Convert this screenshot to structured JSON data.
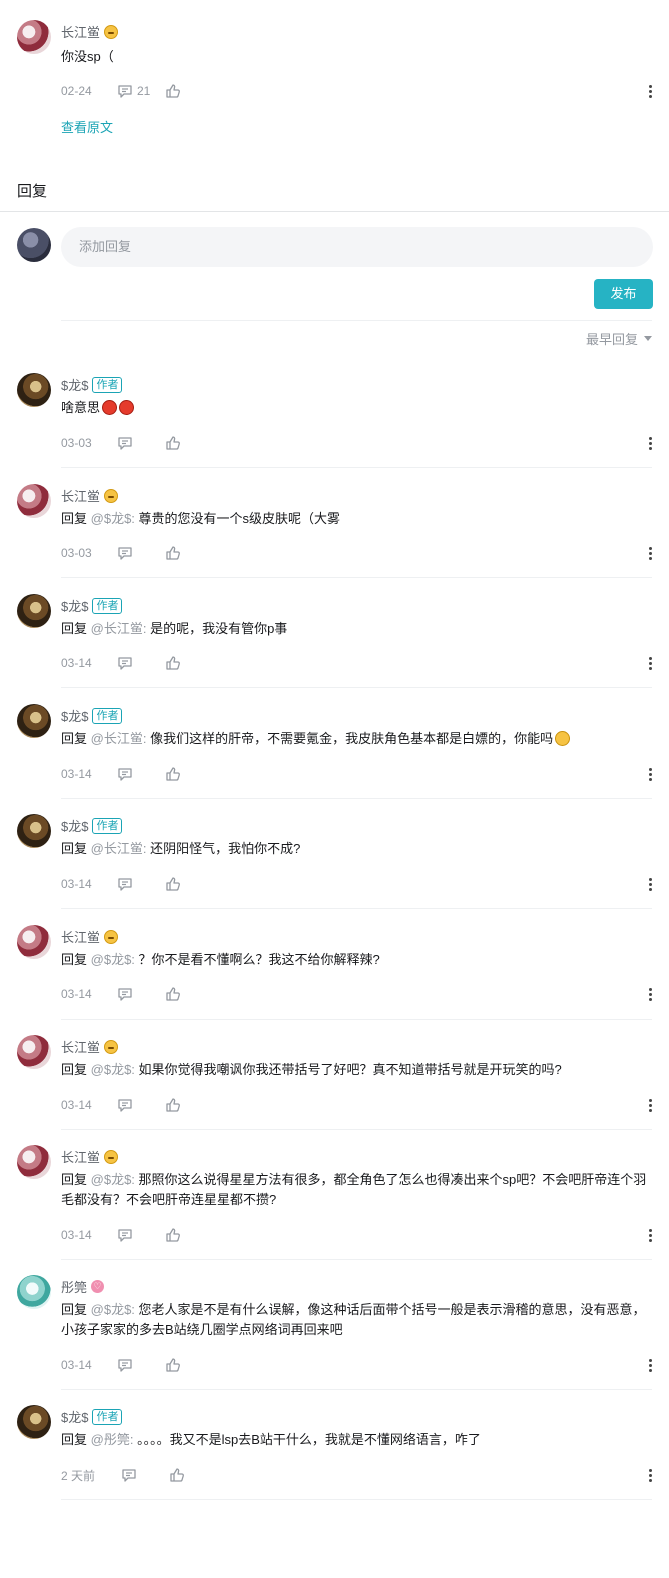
{
  "main_comment": {
    "user": "长江鲎",
    "text": "你没sp（",
    "date": "02-24",
    "reply_count": "21",
    "view_original": "查看原文"
  },
  "reply_section": {
    "title": "回复",
    "input_placeholder": "添加回复",
    "publish_label": "发布",
    "sort_label": "最早回复"
  },
  "author_tag": "作者",
  "reply_prefix": "回复",
  "replies": [
    {
      "user": "$龙$",
      "mention": "",
      "text": "啥意思",
      "date": "03-03"
    },
    {
      "user": "长江鲎",
      "mention": "@$龙$:",
      "text": "尊贵的您没有一个s级皮肤呢（大雾",
      "date": "03-03"
    },
    {
      "user": "$龙$",
      "mention": "@长江鲎:",
      "text": "是的呢，我没有管你p事",
      "date": "03-14"
    },
    {
      "user": "$龙$",
      "mention": "@长江鲎:",
      "text": "像我们这样的肝帝，不需要氪金，我皮肤角色基本都是白嫖的，你能吗",
      "date": "03-14"
    },
    {
      "user": "$龙$",
      "mention": "@长江鲎:",
      "text": "还阴阳怪气，我怕你不成?",
      "date": "03-14"
    },
    {
      "user": "长江鲎",
      "mention": "@$龙$:",
      "text": "？你不是看不懂啊么？我这不给你解释辣?",
      "date": "03-14"
    },
    {
      "user": "长江鲎",
      "mention": "@$龙$:",
      "text": "如果你觉得我嘲讽你我还带括号了好吧？真不知道带括号就是开玩笑的吗?",
      "date": "03-14"
    },
    {
      "user": "长江鲎",
      "mention": "@$龙$:",
      "text": "那照你这么说得星星方法有很多，都全角色了怎么也得凑出来个sp吧？不会吧肝帝连个羽毛都没有？不会吧肝帝连星星都不攒?",
      "date": "03-14"
    },
    {
      "user": "彤筦",
      "mention": "@$龙$:",
      "text": "您老人家是不是有什么误解，像这种话后面带个括号一般是表示滑稽的意思，没有恶意，小孩子家家的多去B站绕几圈学点网络词再回来吧",
      "date": "03-14"
    },
    {
      "user": "$龙$",
      "mention": "@彤筦:",
      "text": "。。。。我又不是lsp去B站干什么，我就是不懂网络语言，咋了",
      "date": "2 天前"
    }
  ],
  "icons": [
    "comment-icon",
    "thumbs-up-icon",
    "more-icon",
    "caret-down-icon"
  ],
  "colors": {
    "accent": "#26b3c4",
    "link": "#1ba4b5",
    "muted": "#9499a0"
  }
}
